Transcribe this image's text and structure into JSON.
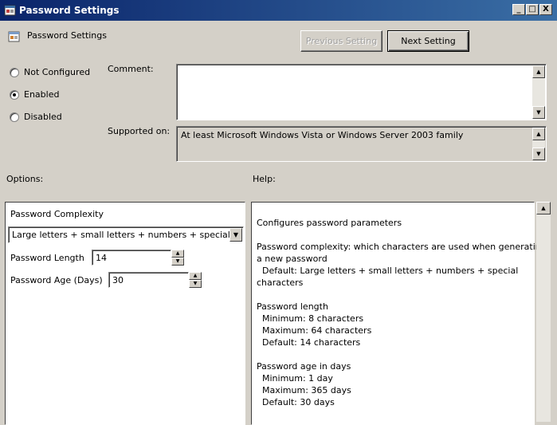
{
  "window": {
    "title": "Password Settings",
    "minimize": "_",
    "maximize": "□",
    "close": "X"
  },
  "header": {
    "policy_title": "Password Settings",
    "previous_label": "Previous Setting",
    "next_label": "Next Setting"
  },
  "state": {
    "options": [
      {
        "label": "Not Configured",
        "checked": false
      },
      {
        "label": "Enabled",
        "checked": true
      },
      {
        "label": "Disabled",
        "checked": false
      }
    ]
  },
  "comment": {
    "label": "Comment:",
    "value": ""
  },
  "supported": {
    "label": "Supported on:",
    "value": "At least Microsoft Windows Vista or Windows Server 2003 family"
  },
  "options_section": {
    "label": "Options:",
    "complexity_label": "Password Complexity",
    "complexity_value": "Large letters + small letters + numbers + specials",
    "length_label": "Password Length",
    "length_value": "14",
    "age_label": "Password Age (Days)",
    "age_value": "30"
  },
  "help_section": {
    "label": "Help:",
    "text": "Configures password parameters\n\nPassword complexity: which characters are used when generating\na new password\n  Default: Large letters + small letters + numbers + special\ncharacters\n\nPassword length\n  Minimum: 8 characters\n  Maximum: 64 characters\n  Default: 14 characters\n\nPassword age in days\n  Minimum: 1 day\n  Maximum: 365 days\n  Default: 30 days"
  }
}
